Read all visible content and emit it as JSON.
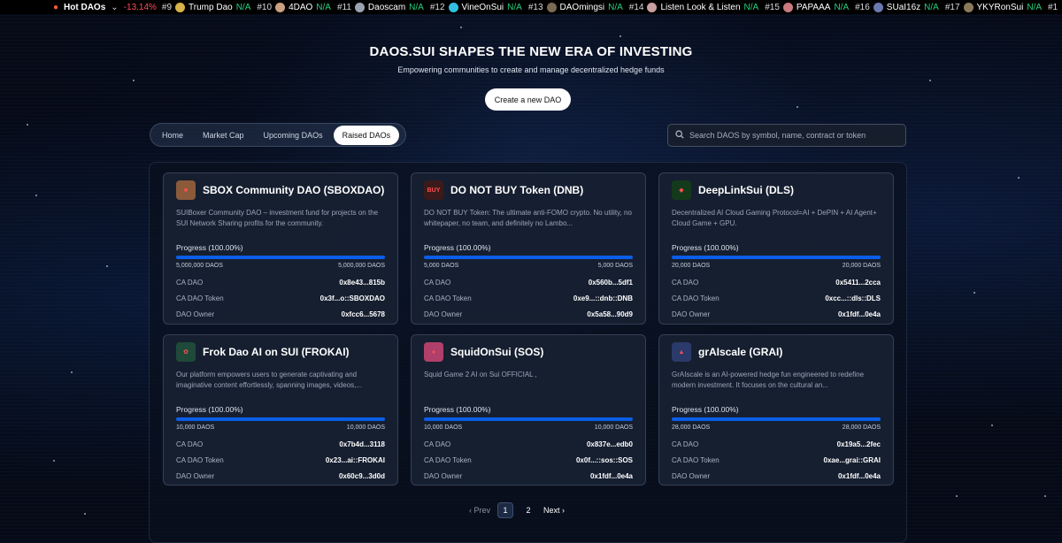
{
  "ticker": {
    "label": "Hot DAOs",
    "change": "-13.14%",
    "items": [
      {
        "rank": "#9",
        "name": "Trump Dao",
        "value": "N/A"
      },
      {
        "rank": "#10",
        "name": "4DAO",
        "value": "N/A"
      },
      {
        "rank": "#11",
        "name": "Daoscam",
        "value": "N/A"
      },
      {
        "rank": "#12",
        "name": "VineOnSui",
        "value": "N/A"
      },
      {
        "rank": "#13",
        "name": "DAOmingsi",
        "value": "N/A"
      },
      {
        "rank": "#14",
        "name": "Listen Look & Listen",
        "value": "N/A"
      },
      {
        "rank": "#15",
        "name": "PAPAAA",
        "value": "N/A"
      },
      {
        "rank": "#16",
        "name": "SUaI16z",
        "value": "N/A"
      },
      {
        "rank": "#17",
        "name": "YKYRonSui",
        "value": "N/A"
      },
      {
        "rank": "#1",
        "name": "",
        "value": ""
      }
    ]
  },
  "hero": {
    "title": "DAOS.SUI SHAPES THE NEW ERA OF INVESTING",
    "subtitle": "Empowering communities to create and manage decentralized hedge funds",
    "create_label": "Create a new DAO"
  },
  "tabs": [
    "Home",
    "Market Cap",
    "Upcoming DAOs",
    "Raised DAOs"
  ],
  "active_tab": "Raised DAOs",
  "search": {
    "placeholder": "Search DAOS by symbol, name, contract or token"
  },
  "labels": {
    "ca_dao": "CA DAO",
    "ca_dao_token": "CA DAO Token",
    "dao_owner": "DAO Owner"
  },
  "cards": [
    {
      "name": "SBOX Community DAO (SBOXDAO)",
      "description": "SUIBoxer Community DAO – investment fund for projects on the SUI Network Sharing profits for the community.",
      "progress": "Progress (100.00%)",
      "progress_fraction": 1.0,
      "raised": "5,000,000 DAOS",
      "target": "5,000,000 DAOS",
      "ca_dao": "0x8e43...815b",
      "ca_dao_token": "0x3f...o::SBOXDAO",
      "owner": "0xfcc6...5678",
      "logo_color": "#8a5a3a"
    },
    {
      "name": "DO NOT BUY Token (DNB)",
      "description": "DO NOT BUY Token: The ultimate anti-FOMO crypto. No utility, no whitepaper, no team, and definitely no Lambo...",
      "progress": "Progress (100.00%)",
      "progress_fraction": 1.0,
      "raised": "5,000 DAOS",
      "target": "5,000 DAOS",
      "ca_dao": "0x560b...5df1",
      "ca_dao_token": "0xe9...::dnb::DNB",
      "owner": "0x5a58...90d9",
      "logo_color": "#3a1a1a"
    },
    {
      "name": "DeepLinkSui (DLS)",
      "description": "Decentralized AI Cloud Gaming Protocol=AI + DePIN + AI Agent+ Cloud Game + GPU.",
      "progress": "Progress (100.00%)",
      "progress_fraction": 1.0,
      "raised": "20,000 DAOS",
      "target": "20,000 DAOS",
      "ca_dao": "0x5411...2cca",
      "ca_dao_token": "0xcc...::dls::DLS",
      "owner": "0x1fdf...0e4a",
      "logo_color": "#143a1c"
    },
    {
      "name": "Frok Dao AI on SUI (FROKAI)",
      "description": "Our platform empowers users to generate captivating and imaginative content effortlessly, spanning images, videos,...",
      "progress": "Progress (100.00%)",
      "progress_fraction": 1.0,
      "raised": "10,000 DAOS",
      "target": "10,000 DAOS",
      "ca_dao": "0x7b4d...3118",
      "ca_dao_token": "0x23...ai::FROKAI",
      "owner": "0x60c9...3d0d",
      "logo_color": "#1f4a3a"
    },
    {
      "name": "SquidOnSui (SOS)",
      "description": "Squid Game 2 AI on Sui OFFICIAL ,",
      "progress": "Progress (100.00%)",
      "progress_fraction": 1.0,
      "raised": "10,000 DAOS",
      "target": "10,000 DAOS",
      "ca_dao": "0x837e...edb0",
      "ca_dao_token": "0x0f...::sos::SOS",
      "owner": "0x1fdf...0e4a",
      "logo_color": "#b0406a"
    },
    {
      "name": "grAIscale (GRAI)",
      "description": "GrAIscale is an AI-powered hedge fun engineered to redefine modern investment. It focuses on the cultural an...",
      "progress": "Progress (100.00%)",
      "progress_fraction": 1.0,
      "raised": "28,000 DAOS",
      "target": "28,000 DAOS",
      "ca_dao": "0x19a5...2fec",
      "ca_dao_token": "0xae...grai::GRAI",
      "owner": "0x1fdf...0e4a",
      "logo_color": "#2a3a6a"
    }
  ],
  "pagination": {
    "prev": "Prev",
    "pages": [
      "1",
      "2"
    ],
    "current": "1",
    "next": "Next"
  }
}
